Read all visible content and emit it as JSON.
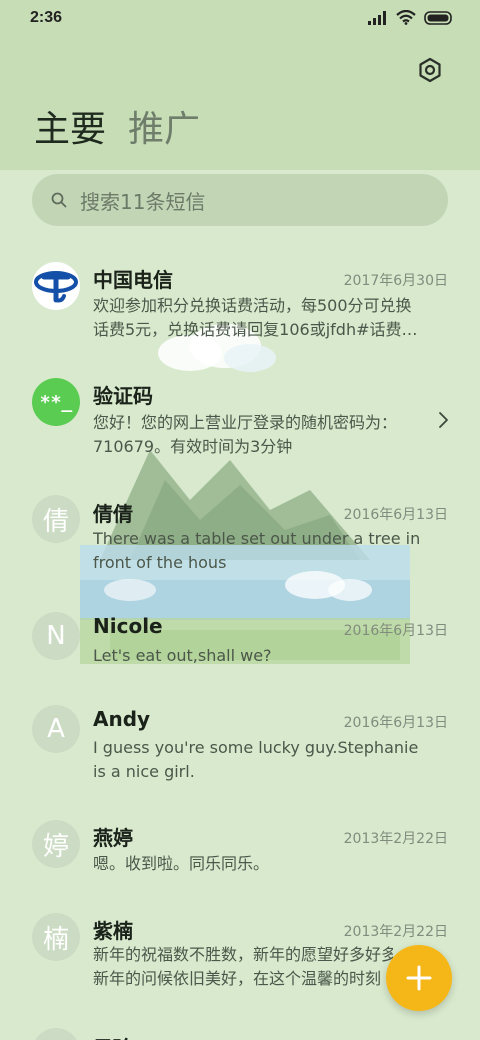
{
  "status_bar": {
    "time": "2:36"
  },
  "header": {
    "tabs": [
      {
        "label": "主要",
        "active": true
      },
      {
        "label": "推广",
        "active": false
      }
    ],
    "settings_icon": "settings-icon"
  },
  "search": {
    "placeholder": "搜索11条短信"
  },
  "conversations": [
    {
      "avatar": {
        "type": "logo",
        "icon": "china-telecom-logo"
      },
      "name": "中国电信",
      "date": "2017年6月30日",
      "preview_lines": [
        "欢迎参加积分兑换话费活动，每500分可兑换",
        "话费5元，兑换话费请回复106或jfdh#话费…"
      ]
    },
    {
      "avatar": {
        "type": "symbol",
        "text": "**_"
      },
      "name": "验证码",
      "date": "",
      "preview_lines": [
        "您好！您的网上营业厅登录的随机密码为：",
        "710679。有效时间为3分钟"
      ],
      "has_chevron": true
    },
    {
      "avatar": {
        "type": "letter",
        "text": "倩"
      },
      "name": "倩倩",
      "date": "2016年6月13日",
      "preview_lines": [
        "There was a table set out under a tree in",
        "front of the hous"
      ]
    },
    {
      "avatar": {
        "type": "letter",
        "text": "N"
      },
      "name": "Nicole",
      "date": "2016年6月13日",
      "preview_lines": [
        "Let's eat out,shall we?"
      ]
    },
    {
      "avatar": {
        "type": "letter",
        "text": "A"
      },
      "name": "Andy",
      "date": "2016年6月13日",
      "preview_lines": [
        "I guess you're some lucky guy.Stephanie",
        "is a nice girl."
      ]
    },
    {
      "avatar": {
        "type": "letter",
        "text": "婷"
      },
      "name": "燕婷",
      "date": "2013年2月22日",
      "preview_lines": [
        "嗯。收到啦。同乐同乐。"
      ]
    },
    {
      "avatar": {
        "type": "letter",
        "text": "楠"
      },
      "name": "紫楠",
      "date": "2013年2月22日",
      "preview_lines": [
        "新年的祝福数不胜数，新年的愿望好多好多，",
        "新年的问候依旧美好，在这个温馨的时刻"
      ]
    },
    {
      "avatar": {
        "type": "letter",
        "text": ""
      },
      "name": "子玲",
      "date": "",
      "preview_lines": []
    }
  ],
  "fab": {
    "icon": "plus-icon"
  },
  "colors": {
    "header_bg": "#c7ddb6",
    "list_bg": "#d8e9cd",
    "fab": "#f5b617",
    "verification_avatar": "#5bcc52",
    "telecom_blue": "#1450a8"
  }
}
